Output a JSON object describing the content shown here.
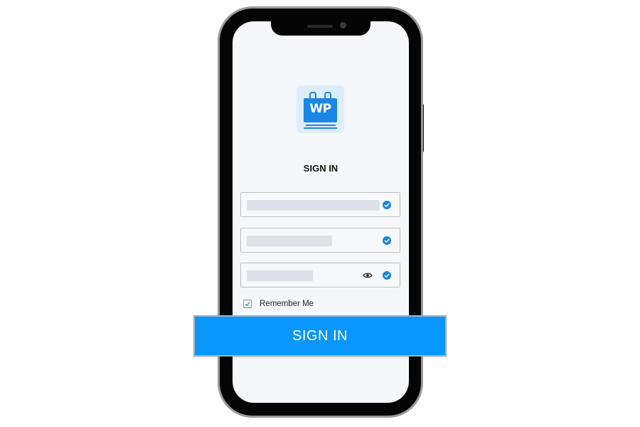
{
  "app": {
    "logo_text": "WP"
  },
  "signin": {
    "title": "SIGN IN",
    "remember_label": "Remember Me",
    "button_label": "SIGN IN",
    "remember_checked": true
  },
  "fields": [
    {
      "name": "username",
      "validated": true
    },
    {
      "name": "email",
      "validated": true
    },
    {
      "name": "password",
      "validated": true,
      "has_visibility_toggle": true
    }
  ],
  "icons": {
    "check": "check-circle-icon",
    "eye": "eye-icon",
    "logo": "calendar-logo-icon"
  },
  "colors": {
    "accent": "#0a96ff",
    "logo_blue": "#1b86e4",
    "logo_tile": "#dceefb",
    "screen_bg": "#f5f7fb",
    "check": "#1b86e4"
  }
}
